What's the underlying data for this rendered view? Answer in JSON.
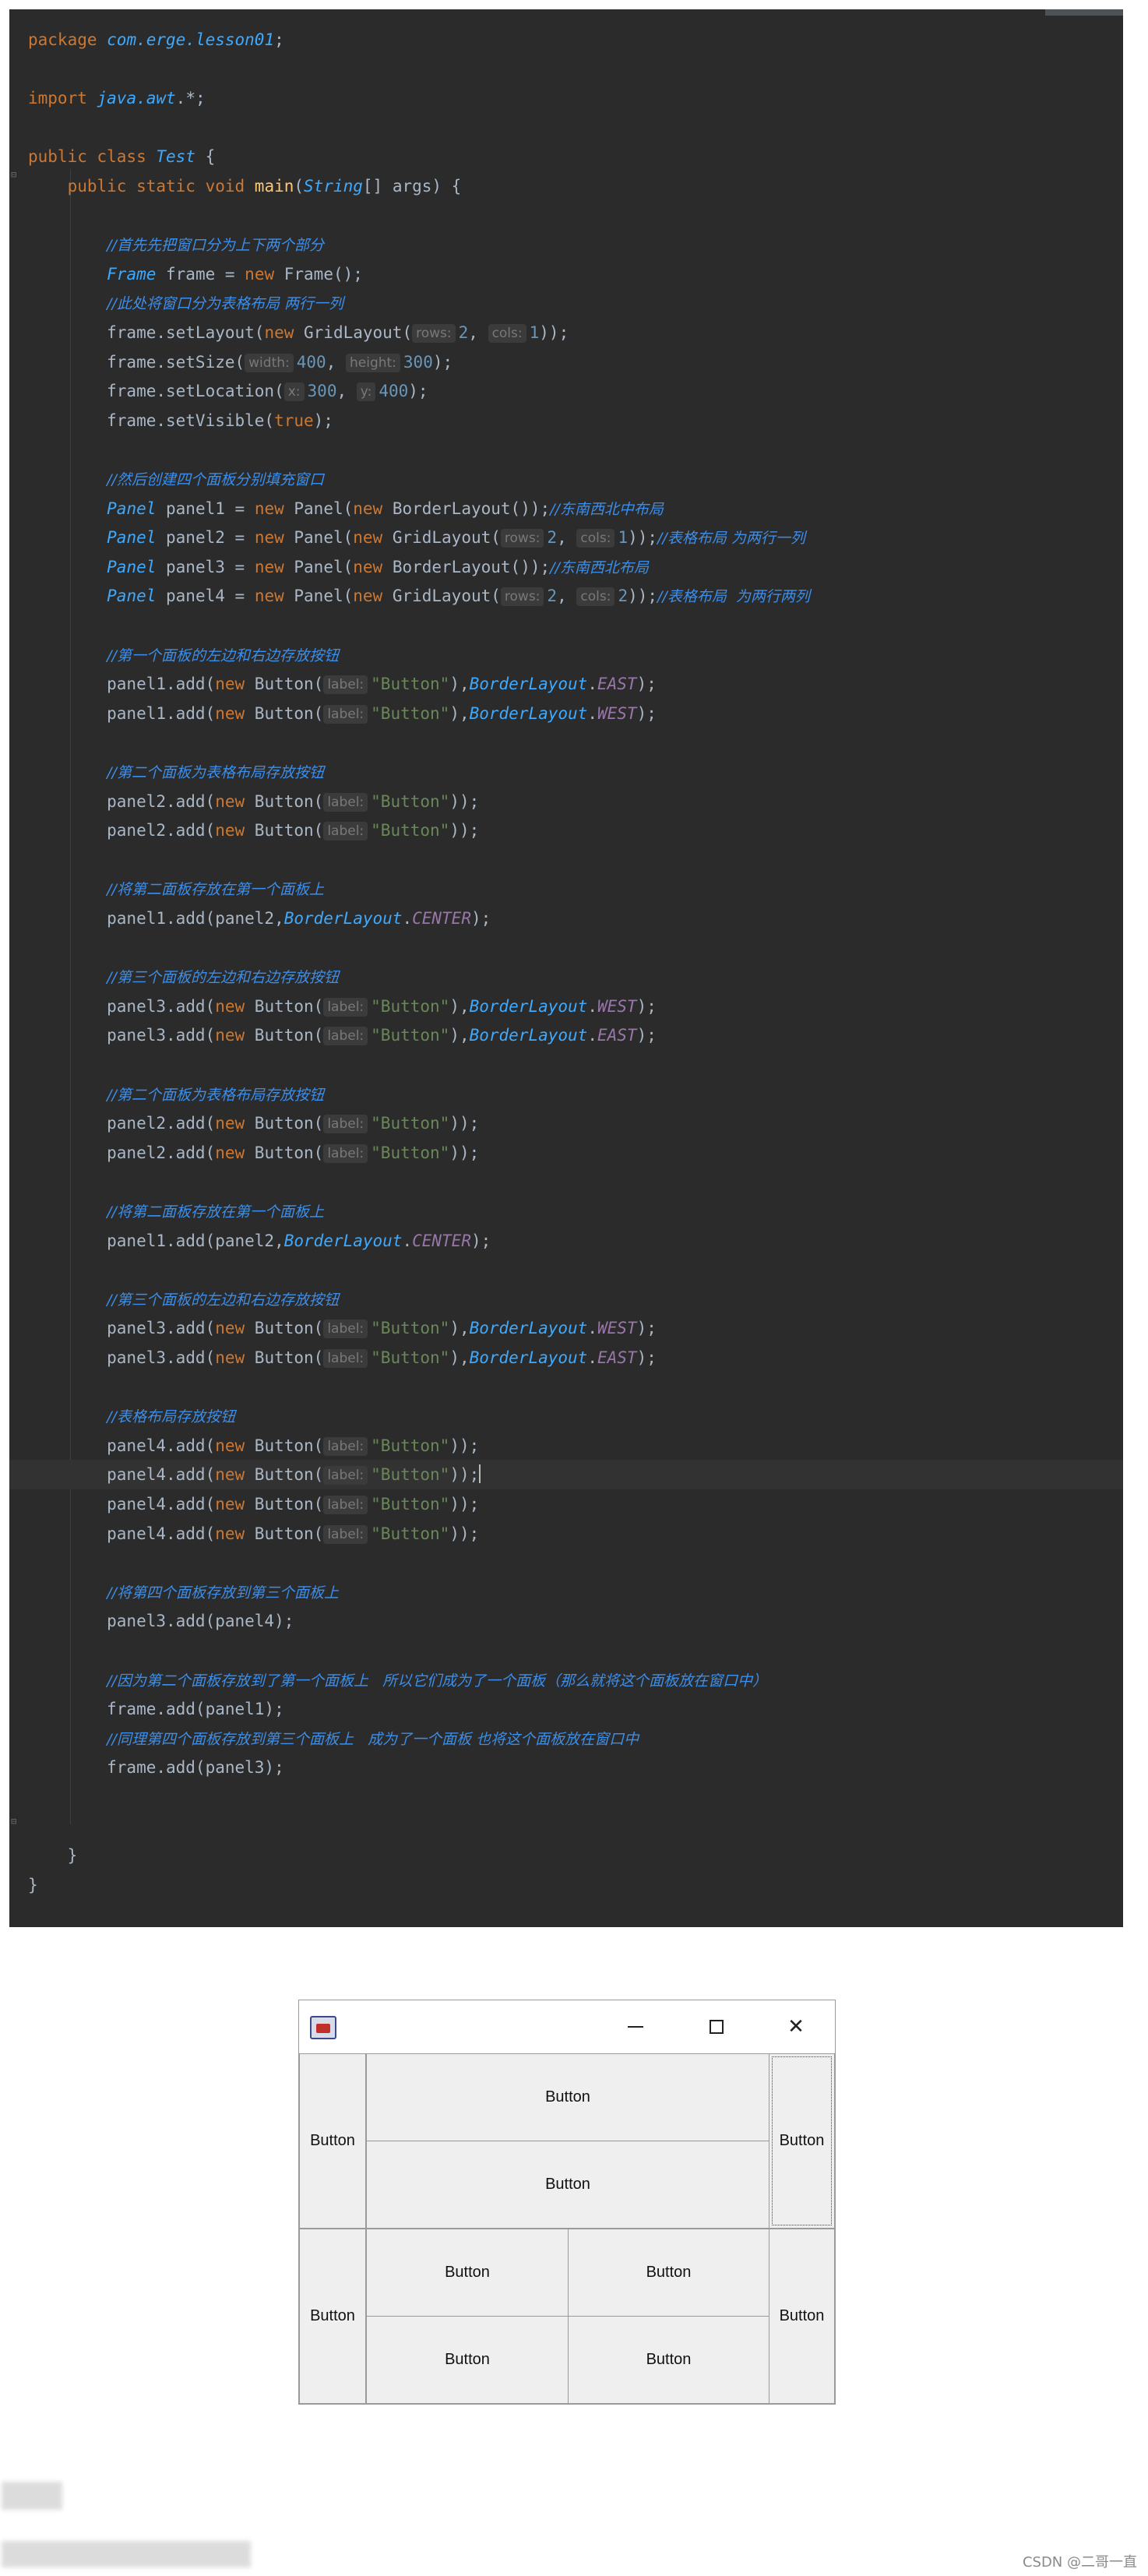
{
  "editor": {
    "lines": [
      [
        {
          "t": "kw",
          "v": "package "
        },
        {
          "t": "pkg",
          "v": "com.erge.lesson01"
        },
        {
          "t": "",
          "v": ";"
        }
      ],
      [],
      [
        {
          "t": "kw",
          "v": "import "
        },
        {
          "t": "pkg",
          "v": "java.awt"
        },
        {
          "t": "",
          "v": ".*;"
        }
      ],
      [],
      [
        {
          "t": "kw",
          "v": "public class "
        },
        {
          "t": "cls",
          "v": "Test"
        },
        {
          "t": "",
          "v": " {"
        }
      ],
      [
        {
          "t": "",
          "v": "    "
        },
        {
          "t": "kw",
          "v": "public static void "
        },
        {
          "t": "fn",
          "v": "main"
        },
        {
          "t": "",
          "v": "("
        },
        {
          "t": "cls",
          "v": "String"
        },
        {
          "t": "",
          "v": "[] args) {"
        }
      ],
      [],
      [
        {
          "t": "",
          "v": "        "
        },
        {
          "t": "cmt",
          "v": "//首先先把窗口分为上下两个部分"
        }
      ],
      [
        {
          "t": "",
          "v": "        "
        },
        {
          "t": "cls",
          "v": "Frame"
        },
        {
          "t": "",
          "v": " frame = "
        },
        {
          "t": "kw",
          "v": "new "
        },
        {
          "t": "",
          "v": "Frame();"
        }
      ],
      [
        {
          "t": "",
          "v": "        "
        },
        {
          "t": "cmt",
          "v": "//此处将窗口分为表格布局 两行一列"
        }
      ],
      [
        {
          "t": "",
          "v": "        frame.setLayout("
        },
        {
          "t": "kw",
          "v": "new "
        },
        {
          "t": "",
          "v": "GridLayout("
        },
        {
          "t": "hint",
          "v": "rows:"
        },
        {
          "t": "num",
          "v": "2"
        },
        {
          "t": "",
          "v": ", "
        },
        {
          "t": "hint",
          "v": "cols:"
        },
        {
          "t": "num",
          "v": "1"
        },
        {
          "t": "",
          "v": "));"
        }
      ],
      [
        {
          "t": "",
          "v": "        frame.setSize("
        },
        {
          "t": "hint",
          "v": "width:"
        },
        {
          "t": "num",
          "v": "400"
        },
        {
          "t": "",
          "v": ", "
        },
        {
          "t": "hint",
          "v": "height:"
        },
        {
          "t": "num",
          "v": "300"
        },
        {
          "t": "",
          "v": ");"
        }
      ],
      [
        {
          "t": "",
          "v": "        frame.setLocation("
        },
        {
          "t": "hint",
          "v": "x:"
        },
        {
          "t": "num",
          "v": "300"
        },
        {
          "t": "",
          "v": ", "
        },
        {
          "t": "hint",
          "v": "y:"
        },
        {
          "t": "num",
          "v": "400"
        },
        {
          "t": "",
          "v": ");"
        }
      ],
      [
        {
          "t": "",
          "v": "        frame.setVisible("
        },
        {
          "t": "kw",
          "v": "true"
        },
        {
          "t": "",
          "v": ");"
        }
      ],
      [],
      [
        {
          "t": "",
          "v": "        "
        },
        {
          "t": "cmt",
          "v": "//然后创建四个面板分别填充窗口"
        }
      ],
      [
        {
          "t": "",
          "v": "        "
        },
        {
          "t": "cls",
          "v": "Panel"
        },
        {
          "t": "",
          "v": " panel1 = "
        },
        {
          "t": "kw",
          "v": "new "
        },
        {
          "t": "",
          "v": "Panel("
        },
        {
          "t": "kw",
          "v": "new "
        },
        {
          "t": "",
          "v": "BorderLayout());"
        },
        {
          "t": "cmt",
          "v": "//东南西北中布局"
        }
      ],
      [
        {
          "t": "",
          "v": "        "
        },
        {
          "t": "cls",
          "v": "Panel"
        },
        {
          "t": "",
          "v": " panel2 = "
        },
        {
          "t": "kw",
          "v": "new "
        },
        {
          "t": "",
          "v": "Panel("
        },
        {
          "t": "kw",
          "v": "new "
        },
        {
          "t": "",
          "v": "GridLayout("
        },
        {
          "t": "hint",
          "v": "rows:"
        },
        {
          "t": "num",
          "v": "2"
        },
        {
          "t": "",
          "v": ", "
        },
        {
          "t": "hint",
          "v": "cols:"
        },
        {
          "t": "num",
          "v": "1"
        },
        {
          "t": "",
          "v": "));"
        },
        {
          "t": "cmt",
          "v": "//表格布局 为两行一列"
        }
      ],
      [
        {
          "t": "",
          "v": "        "
        },
        {
          "t": "cls",
          "v": "Panel"
        },
        {
          "t": "",
          "v": " panel3 = "
        },
        {
          "t": "kw",
          "v": "new "
        },
        {
          "t": "",
          "v": "Panel("
        },
        {
          "t": "kw",
          "v": "new "
        },
        {
          "t": "",
          "v": "BorderLayout());"
        },
        {
          "t": "cmt",
          "v": "//东南西北布局"
        }
      ],
      [
        {
          "t": "",
          "v": "        "
        },
        {
          "t": "cls",
          "v": "Panel"
        },
        {
          "t": "",
          "v": " panel4 = "
        },
        {
          "t": "kw",
          "v": "new "
        },
        {
          "t": "",
          "v": "Panel("
        },
        {
          "t": "kw",
          "v": "new "
        },
        {
          "t": "",
          "v": "GridLayout("
        },
        {
          "t": "hint",
          "v": "rows:"
        },
        {
          "t": "num",
          "v": "2"
        },
        {
          "t": "",
          "v": ", "
        },
        {
          "t": "hint",
          "v": "cols:"
        },
        {
          "t": "num",
          "v": "2"
        },
        {
          "t": "",
          "v": "));"
        },
        {
          "t": "cmt",
          "v": "//表格布局  为两行两列"
        }
      ],
      [],
      [
        {
          "t": "",
          "v": "        "
        },
        {
          "t": "cmt",
          "v": "//第一个面板的左边和右边存放按钮"
        }
      ],
      [
        {
          "t": "",
          "v": "        panel1.add("
        },
        {
          "t": "kw",
          "v": "new "
        },
        {
          "t": "",
          "v": "Button("
        },
        {
          "t": "hint",
          "v": "label:"
        },
        {
          "t": "str",
          "v": "\"Button\""
        },
        {
          "t": "",
          "v": "),"
        },
        {
          "t": "cls",
          "v": "BorderLayout"
        },
        {
          "t": "",
          "v": "."
        },
        {
          "t": "static",
          "v": "EAST"
        },
        {
          "t": "",
          "v": ");"
        }
      ],
      [
        {
          "t": "",
          "v": "        panel1.add("
        },
        {
          "t": "kw",
          "v": "new "
        },
        {
          "t": "",
          "v": "Button("
        },
        {
          "t": "hint",
          "v": "label:"
        },
        {
          "t": "str",
          "v": "\"Button\""
        },
        {
          "t": "",
          "v": "),"
        },
        {
          "t": "cls",
          "v": "BorderLayout"
        },
        {
          "t": "",
          "v": "."
        },
        {
          "t": "static",
          "v": "WEST"
        },
        {
          "t": "",
          "v": ");"
        }
      ],
      [],
      [
        {
          "t": "",
          "v": "        "
        },
        {
          "t": "cmt",
          "v": "//第二个面板为表格布局存放按钮"
        }
      ],
      [
        {
          "t": "",
          "v": "        panel2.add("
        },
        {
          "t": "kw",
          "v": "new "
        },
        {
          "t": "",
          "v": "Button("
        },
        {
          "t": "hint",
          "v": "label:"
        },
        {
          "t": "str",
          "v": "\"Button\""
        },
        {
          "t": "",
          "v": "));"
        }
      ],
      [
        {
          "t": "",
          "v": "        panel2.add("
        },
        {
          "t": "kw",
          "v": "new "
        },
        {
          "t": "",
          "v": "Button("
        },
        {
          "t": "hint",
          "v": "label:"
        },
        {
          "t": "str",
          "v": "\"Button\""
        },
        {
          "t": "",
          "v": "));"
        }
      ],
      [],
      [
        {
          "t": "",
          "v": "        "
        },
        {
          "t": "cmt",
          "v": "//将第二面板存放在第一个面板上"
        }
      ],
      [
        {
          "t": "",
          "v": "        panel1.add(panel2,"
        },
        {
          "t": "cls",
          "v": "BorderLayout"
        },
        {
          "t": "",
          "v": "."
        },
        {
          "t": "static",
          "v": "CENTER"
        },
        {
          "t": "",
          "v": ");"
        }
      ],
      [],
      [
        {
          "t": "",
          "v": "        "
        },
        {
          "t": "cmt",
          "v": "//第三个面板的左边和右边存放按钮"
        }
      ],
      [
        {
          "t": "",
          "v": "        panel3.add("
        },
        {
          "t": "kw",
          "v": "new "
        },
        {
          "t": "",
          "v": "Button("
        },
        {
          "t": "hint",
          "v": "label:"
        },
        {
          "t": "str",
          "v": "\"Button\""
        },
        {
          "t": "",
          "v": "),"
        },
        {
          "t": "cls",
          "v": "BorderLayout"
        },
        {
          "t": "",
          "v": "."
        },
        {
          "t": "static",
          "v": "WEST"
        },
        {
          "t": "",
          "v": ");"
        }
      ],
      [
        {
          "t": "",
          "v": "        panel3.add("
        },
        {
          "t": "kw",
          "v": "new "
        },
        {
          "t": "",
          "v": "Button("
        },
        {
          "t": "hint",
          "v": "label:"
        },
        {
          "t": "str",
          "v": "\"Button\""
        },
        {
          "t": "",
          "v": "),"
        },
        {
          "t": "cls",
          "v": "BorderLayout"
        },
        {
          "t": "",
          "v": "."
        },
        {
          "t": "static",
          "v": "EAST"
        },
        {
          "t": "",
          "v": ");"
        }
      ],
      [],
      [
        {
          "t": "",
          "v": "        "
        },
        {
          "t": "cmt",
          "v": "//第二个面板为表格布局存放按钮"
        }
      ],
      [
        {
          "t": "",
          "v": "        panel2.add("
        },
        {
          "t": "kw",
          "v": "new "
        },
        {
          "t": "",
          "v": "Button("
        },
        {
          "t": "hint",
          "v": "label:"
        },
        {
          "t": "str",
          "v": "\"Button\""
        },
        {
          "t": "",
          "v": "));"
        }
      ],
      [
        {
          "t": "",
          "v": "        panel2.add("
        },
        {
          "t": "kw",
          "v": "new "
        },
        {
          "t": "",
          "v": "Button("
        },
        {
          "t": "hint",
          "v": "label:"
        },
        {
          "t": "str",
          "v": "\"Button\""
        },
        {
          "t": "",
          "v": "));"
        }
      ],
      [],
      [
        {
          "t": "",
          "v": "        "
        },
        {
          "t": "cmt",
          "v": "//将第二面板存放在第一个面板上"
        }
      ],
      [
        {
          "t": "",
          "v": "        panel1.add(panel2,"
        },
        {
          "t": "cls",
          "v": "BorderLayout"
        },
        {
          "t": "",
          "v": "."
        },
        {
          "t": "static",
          "v": "CENTER"
        },
        {
          "t": "",
          "v": ");"
        }
      ],
      [],
      [
        {
          "t": "",
          "v": "        "
        },
        {
          "t": "cmt",
          "v": "//第三个面板的左边和右边存放按钮"
        }
      ],
      [
        {
          "t": "",
          "v": "        panel3.add("
        },
        {
          "t": "kw",
          "v": "new "
        },
        {
          "t": "",
          "v": "Button("
        },
        {
          "t": "hint",
          "v": "label:"
        },
        {
          "t": "str",
          "v": "\"Button\""
        },
        {
          "t": "",
          "v": "),"
        },
        {
          "t": "cls",
          "v": "BorderLayout"
        },
        {
          "t": "",
          "v": "."
        },
        {
          "t": "static",
          "v": "WEST"
        },
        {
          "t": "",
          "v": ");"
        }
      ],
      [
        {
          "t": "",
          "v": "        panel3.add("
        },
        {
          "t": "kw",
          "v": "new "
        },
        {
          "t": "",
          "v": "Button("
        },
        {
          "t": "hint",
          "v": "label:"
        },
        {
          "t": "str",
          "v": "\"Button\""
        },
        {
          "t": "",
          "v": "),"
        },
        {
          "t": "cls",
          "v": "BorderLayout"
        },
        {
          "t": "",
          "v": "."
        },
        {
          "t": "static",
          "v": "EAST"
        },
        {
          "t": "",
          "v": ");"
        }
      ],
      [],
      [
        {
          "t": "",
          "v": "        "
        },
        {
          "t": "cmt",
          "v": "//表格布局存放按钮"
        }
      ],
      [
        {
          "t": "",
          "v": "        panel4.add("
        },
        {
          "t": "kw",
          "v": "new "
        },
        {
          "t": "",
          "v": "Button("
        },
        {
          "t": "hint",
          "v": "label:"
        },
        {
          "t": "str",
          "v": "\"Button\""
        },
        {
          "t": "",
          "v": "));"
        }
      ],
      [
        {
          "t": "",
          "v": "        panel4.add("
        },
        {
          "t": "kw",
          "v": "new "
        },
        {
          "t": "",
          "v": "Button("
        },
        {
          "t": "hint",
          "v": "label:"
        },
        {
          "t": "str",
          "v": "\"Button\""
        },
        {
          "t": "",
          "v": "));"
        },
        {
          "t": "caret",
          "v": ""
        }
      ],
      [
        {
          "t": "",
          "v": "        panel4.add("
        },
        {
          "t": "kw",
          "v": "new "
        },
        {
          "t": "",
          "v": "Button("
        },
        {
          "t": "hint",
          "v": "label:"
        },
        {
          "t": "str",
          "v": "\"Button\""
        },
        {
          "t": "",
          "v": "));"
        }
      ],
      [
        {
          "t": "",
          "v": "        panel4.add("
        },
        {
          "t": "kw",
          "v": "new "
        },
        {
          "t": "",
          "v": "Button("
        },
        {
          "t": "hint",
          "v": "label:"
        },
        {
          "t": "str",
          "v": "\"Button\""
        },
        {
          "t": "",
          "v": "));"
        }
      ],
      [],
      [
        {
          "t": "",
          "v": "        "
        },
        {
          "t": "cmt",
          "v": "//将第四个面板存放到第三个面板上"
        }
      ],
      [
        {
          "t": "",
          "v": "        panel3.add(panel4);"
        }
      ],
      [],
      [
        {
          "t": "",
          "v": "        "
        },
        {
          "t": "cmt",
          "v": "//因为第二个面板存放到了第一个面板上   所以它们成为了一个面板（那么就将这个面板放在窗口中）"
        }
      ],
      [
        {
          "t": "",
          "v": "        frame.add(panel1);"
        }
      ],
      [
        {
          "t": "",
          "v": "        "
        },
        {
          "t": "cmt",
          "v": "//同理第四个面板存放到第三个面板上   成为了一个面板 也将这个面板放在窗口中"
        }
      ],
      [
        {
          "t": "",
          "v": "        frame.add(panel3);"
        }
      ],
      [],
      [],
      [
        {
          "t": "",
          "v": "    }"
        }
      ],
      [
        {
          "t": "",
          "v": "}"
        }
      ]
    ],
    "current_line": 49
  },
  "awt_window": {
    "minimize_glyph": "",
    "close_glyph": "✕",
    "panel1": {
      "west": "Button",
      "east": "Button",
      "center_top": "Button",
      "center_bottom": "Button"
    },
    "panel3": {
      "west": "Button",
      "east": "Button",
      "grid": [
        "Button",
        "Button",
        "Button",
        "Button"
      ]
    }
  },
  "watermark": "CSDN @二哥一直",
  "colors": {
    "editor_bg": "#2b2b2b",
    "keyword": "#cc7832",
    "class": "#3daaff",
    "comment": "#3b8eea",
    "string": "#6a8759",
    "number": "#6897bb"
  }
}
